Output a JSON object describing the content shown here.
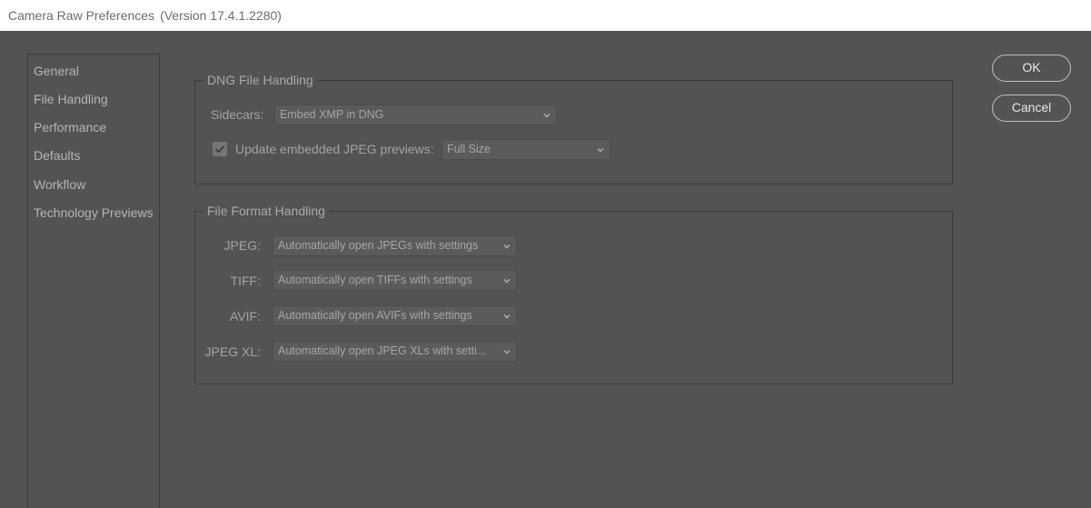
{
  "window": {
    "title": "Camera Raw Preferences",
    "version": "(Version 17.4.1.2280)"
  },
  "sidebar": {
    "items": [
      {
        "label": "General"
      },
      {
        "label": "File Handling"
      },
      {
        "label": "Performance"
      },
      {
        "label": "Defaults"
      },
      {
        "label": "Workflow"
      },
      {
        "label": "Technology Previews"
      }
    ]
  },
  "dng": {
    "title": "DNG File Handling",
    "sidecars_label": "Sidecars:",
    "sidecars_value": "Embed XMP in DNG",
    "update_checked": true,
    "update_label": "Update embedded JPEG previews:",
    "update_value": "Full Size"
  },
  "formats": {
    "title": "File Format Handling",
    "rows": [
      {
        "label": "JPEG:",
        "value": "Automatically open JPEGs with settings"
      },
      {
        "label": "TIFF:",
        "value": "Automatically open TIFFs with settings"
      },
      {
        "label": "AVIF:",
        "value": "Automatically open AVIFs with settings"
      },
      {
        "label": "JPEG XL:",
        "value": "Automatically open JPEG XLs with setti..."
      }
    ]
  },
  "buttons": {
    "ok": "OK",
    "cancel": "Cancel"
  },
  "colors": {
    "background": "#535353",
    "titlebar": "#ffffff",
    "border": "#3c3c3c"
  }
}
